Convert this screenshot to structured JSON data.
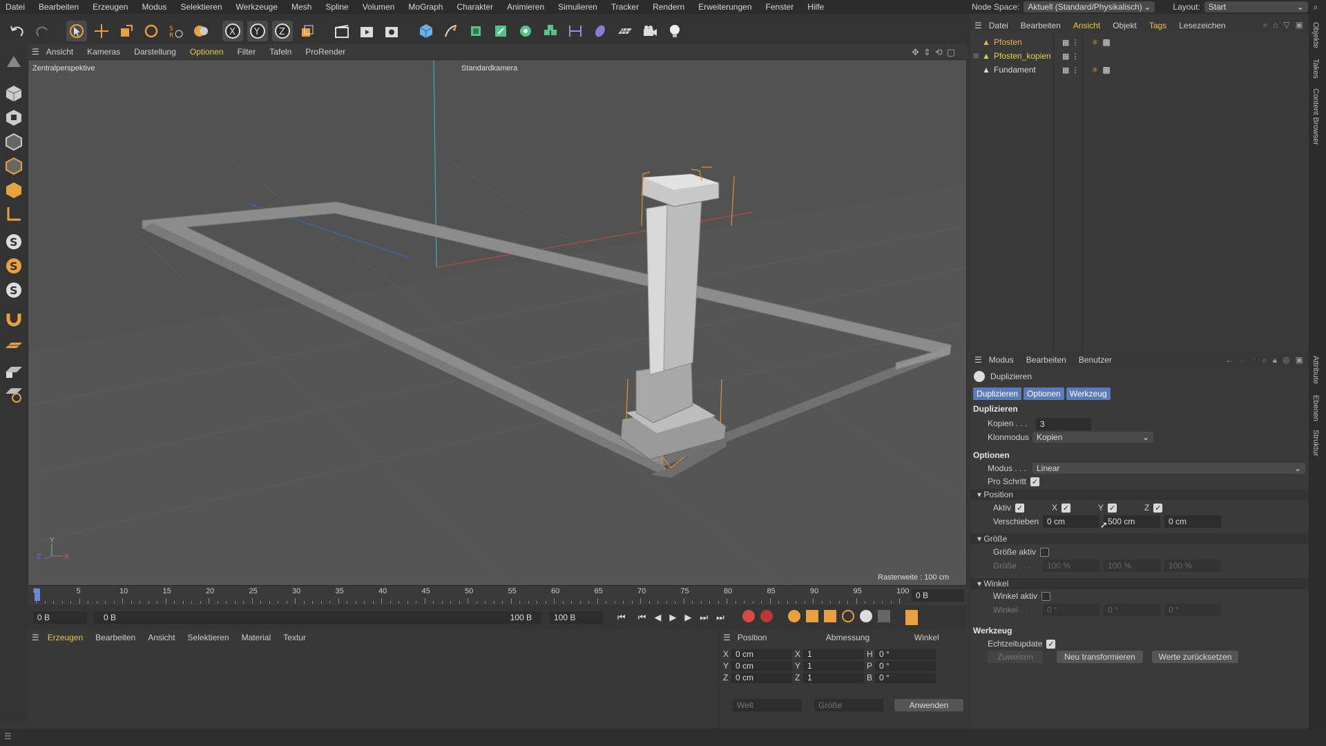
{
  "menubar": [
    "Datei",
    "Bearbeiten",
    "Erzeugen",
    "Modus",
    "Selektieren",
    "Werkzeuge",
    "Mesh",
    "Spline",
    "Volumen",
    "MoGraph",
    "Charakter",
    "Animieren",
    "Simulieren",
    "Tracker",
    "Rendern",
    "Erweiterungen",
    "Fenster",
    "Hilfe"
  ],
  "topright": {
    "node_space_label": "Node Space:",
    "node_space_value": "Aktuell (Standard/Physikalisch)",
    "layout_label": "Layout:",
    "layout_value": "Start"
  },
  "viewport": {
    "menu": [
      "Ansicht",
      "Kameras",
      "Darstellung",
      "Optionen",
      "Filter",
      "Tafeln",
      "ProRender"
    ],
    "perspective_label": "Zentralperspektive",
    "camera_label": "Standardkamera",
    "grid_label": "Rasterweite : 100 cm",
    "axis_x": "X",
    "axis_y": "Y",
    "axis_z": "Z"
  },
  "timeline": {
    "ticks": [
      "0",
      "5",
      "10",
      "15",
      "20",
      "25",
      "30",
      "35",
      "40",
      "45",
      "50",
      "55",
      "60",
      "65",
      "70",
      "75",
      "80",
      "85",
      "90",
      "95",
      "100"
    ],
    "current_frame": "0 B"
  },
  "transport": {
    "start": "0 B",
    "range_start": "0 B",
    "range_end": "100 B",
    "end": "100 B"
  },
  "material_panel": {
    "menu": [
      "Erzeugen",
      "Bearbeiten",
      "Ansicht",
      "Selektieren",
      "Material",
      "Textur"
    ]
  },
  "coord_panel": {
    "headers": [
      "Position",
      "Abmessung",
      "Winkel"
    ],
    "rows": [
      {
        "axis": "X",
        "pos": "0 cm",
        "size_axis": "X",
        "size": "1",
        "rot_axis": "H",
        "rot": "0 °"
      },
      {
        "axis": "Y",
        "pos": "0 cm",
        "size_axis": "Y",
        "size": "1",
        "rot_axis": "P",
        "rot": "0 °"
      },
      {
        "axis": "Z",
        "pos": "0 cm",
        "size_axis": "Z",
        "size": "1",
        "rot_axis": "B",
        "rot": "0 °"
      }
    ],
    "space": "Welt",
    "size_mode": "Größe",
    "apply": "Anwenden"
  },
  "object_panel": {
    "menu": [
      "Datei",
      "Bearbeiten",
      "Ansicht",
      "Objekt",
      "Tags",
      "Lesezeichen"
    ],
    "objects": [
      {
        "name": "Pfosten",
        "color": "#e8b24a"
      },
      {
        "name": "Pfosten_kopien",
        "color": "#e8d24a"
      },
      {
        "name": "Fundament",
        "color": "#d8d8d8"
      }
    ]
  },
  "attr_panel": {
    "menu": [
      "Modus",
      "Bearbeiten",
      "Benutzer"
    ],
    "object_title": "Duplizieren",
    "tabs": [
      "Duplizieren",
      "Optionen",
      "Werkzeug"
    ],
    "sec_duplizieren": "Duplizieren",
    "kopien_label": "Kopien . . .",
    "kopien_value": "3",
    "klonmodus_label": "Klonmodus",
    "klonmodus_value": "Kopien",
    "sec_optionen": "Optionen",
    "modus_label": "Modus . . .",
    "modus_value": "Linear",
    "proschritt_label": "Pro Schritt",
    "grp_position": "Position",
    "aktiv_label": "Aktiv",
    "x_label": "X",
    "y_label": "Y",
    "z_label": "Z",
    "verschieben_label": "Verschieben",
    "verschieben_x": "0 cm",
    "verschieben_y": "500 cm",
    "verschieben_z": "0 cm",
    "grp_groesse": "Größe",
    "groesse_aktiv_label": "Größe aktiv",
    "groesse_label": "Größe . . .",
    "groesse_x": "100 %",
    "groesse_y": "100 %",
    "groesse_z": "100 %",
    "grp_winkel": "Winkel",
    "winkel_aktiv_label": "Winkel aktiv",
    "winkel_label": "Winkel . .",
    "winkel_x": "0 °",
    "winkel_y": "0 °",
    "winkel_z": "0 °",
    "sec_werkzeug": "Werkzeug",
    "echtzeit_label": "Echtzeitupdate",
    "btn_zuweisen": "Zuweisen",
    "btn_neu": "Neu transformieren",
    "btn_reset": "Werte zurücksetzen"
  },
  "right_strip": [
    "Objekte",
    "Takes",
    "Content Browser",
    "Attribute",
    "Ebenen",
    "Struktur"
  ],
  "colors": {
    "accent_blue": "#5b7cb8",
    "menu_highlight": "#e8c64a"
  }
}
